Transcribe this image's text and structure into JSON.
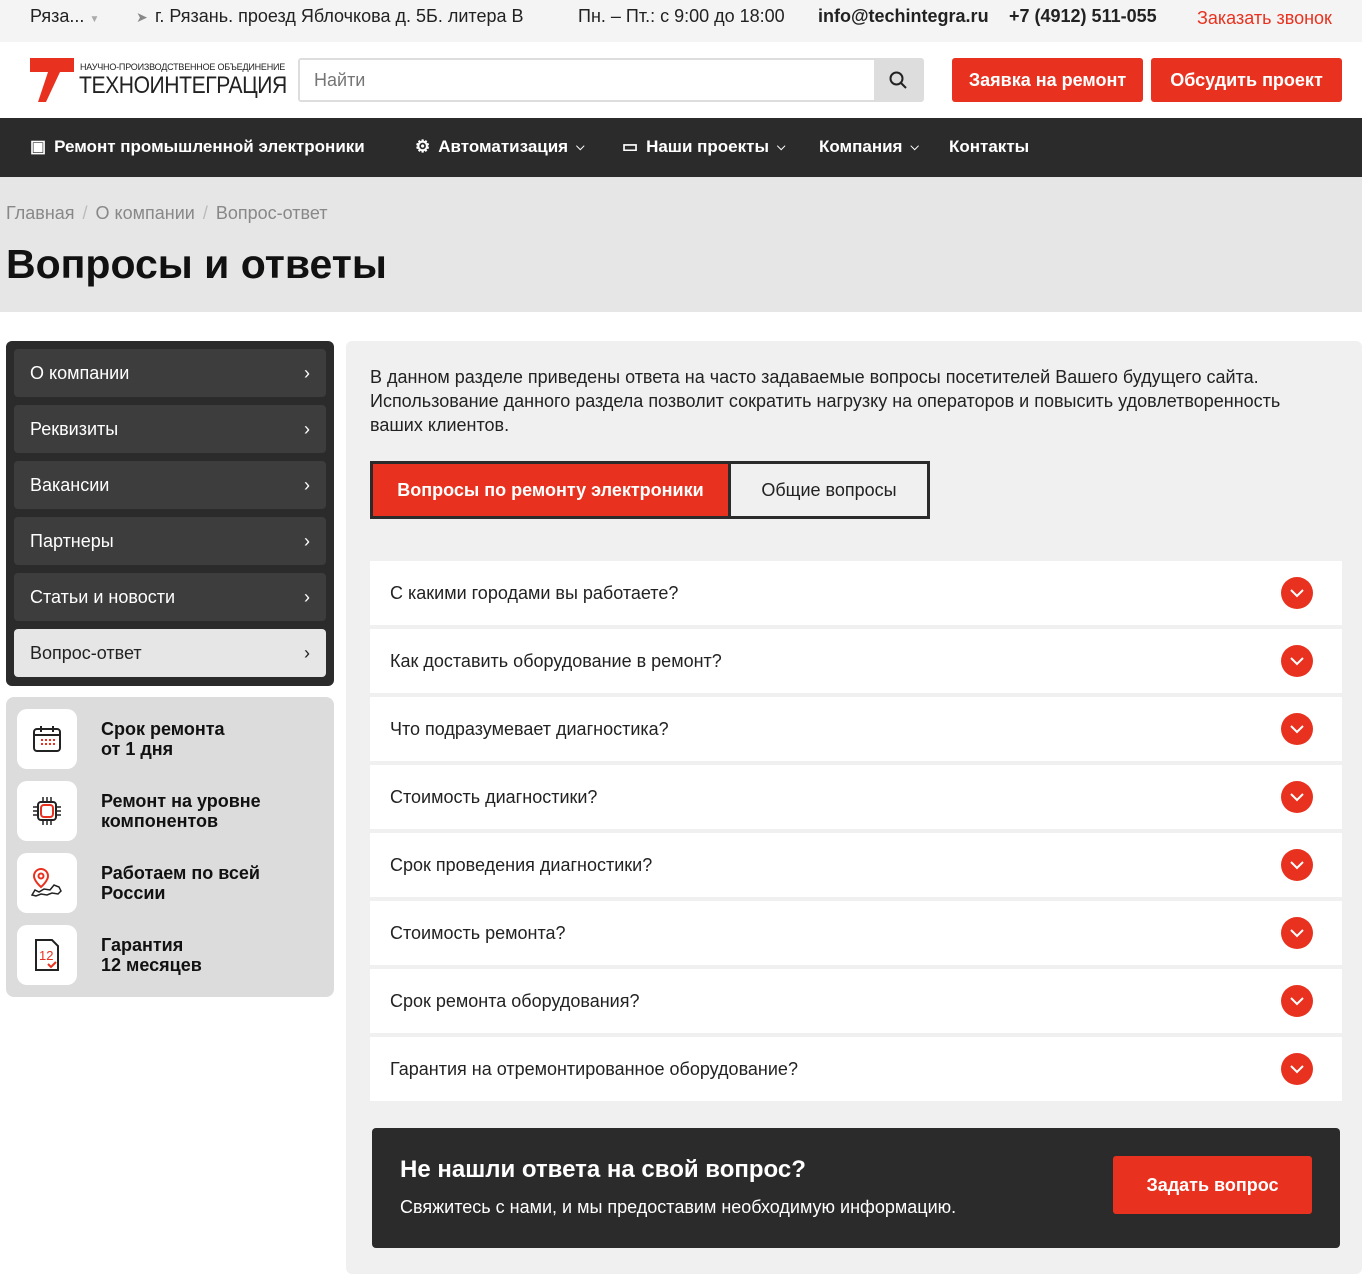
{
  "topbar": {
    "city": "Ряза...",
    "address": "г. Рязань. проезд Яблочкова д. 5Б. литера В",
    "hours": "Пн. – Пт.: с 9:00 до 18:00",
    "email": "info@techintegra.ru",
    "phone": "+7 (4912) 511-055",
    "callback": "Заказать звонок"
  },
  "header": {
    "logo_small": "НАУЧНО-ПРОИЗВОДСТВЕННОЕ ОБЪЕДИНЕНИЕ",
    "logo_big": "ТЕХНОИНТЕГРАЦИЯ",
    "search_placeholder": "Найти",
    "btn_repair": "Заявка на ремонт",
    "btn_project": "Обсудить проект"
  },
  "nav": [
    "Ремонт промышленной электроники",
    "Автоматизация",
    "Наши проекты",
    "Компания",
    "Контакты"
  ],
  "breadcrumbs": [
    "Главная",
    "О компании",
    "Вопрос-ответ"
  ],
  "title": "Вопросы и ответы",
  "sidebar": [
    "О компании",
    "Реквизиты",
    "Вакансии",
    "Партнеры",
    "Статьи и новости",
    "Вопрос-ответ"
  ],
  "features": [
    {
      "line1": "Срок ремонта",
      "line2": "от 1 дня"
    },
    {
      "line1": "Ремонт на уровне",
      "line2": "компонентов"
    },
    {
      "line1": "Работаем по всей",
      "line2": "России"
    },
    {
      "line1": "Гарантия",
      "line2": "12 месяцев"
    }
  ],
  "intro": "В данном разделе приведены ответа на часто задаваемые вопросы посетителей Вашего будущего сайта. Использование данного раздела позволит сократить нагрузку на операторов и повысить удовлетворенность ваших клиентов.",
  "tabs": [
    "Вопросы по ремонту электроники",
    "Общие вопросы"
  ],
  "faq": [
    "С какими городами вы работаете?",
    "Как доставить оборудование в ремонт?",
    "Что подразумевает диагностика?",
    "Стоимость диагностики?",
    "Срок проведения диагностики?",
    "Стоимость ремонта?",
    "Срок ремонта оборудования?",
    "Гарантия на отремонтированное оборудование?"
  ],
  "cta": {
    "title": "Не нашли ответа на свой вопрос?",
    "text": "Свяжитесь с нами, и мы предоставим необходимую информацию.",
    "button": "Задать вопрос"
  },
  "colors": {
    "accent": "#e8321f",
    "dark": "#2b2b2b"
  }
}
